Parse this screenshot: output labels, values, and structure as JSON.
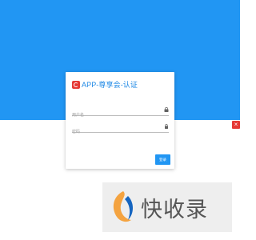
{
  "app": {
    "title": "APP-尊享会-认证"
  },
  "form": {
    "username_placeholder": "用户名",
    "password_placeholder": "密码",
    "submit_label": "登录"
  },
  "icons": {
    "username": "lock-icon",
    "password": "lock-icon",
    "close": "close-icon"
  },
  "watermark": {
    "text": "快收录"
  },
  "colors": {
    "accent": "#2196f3",
    "brand": "#e53935",
    "title": "#1e88e5"
  }
}
